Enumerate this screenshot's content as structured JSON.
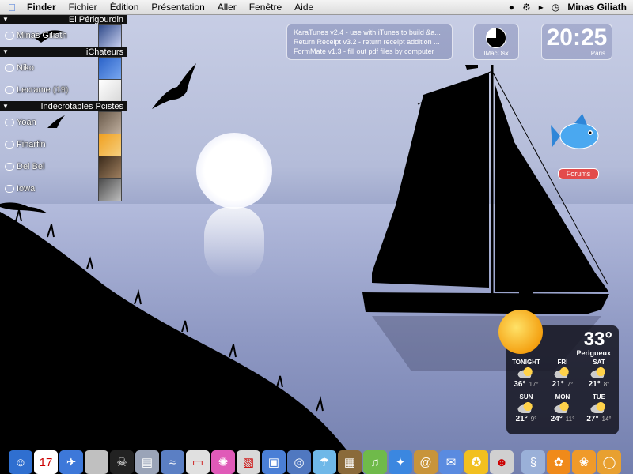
{
  "menubar": {
    "app": "Finder",
    "menus": [
      "Fichier",
      "Édition",
      "Présentation",
      "Aller",
      "Fenêtre",
      "Aide"
    ],
    "user": "Minas Giliath",
    "icons": [
      "apple-icon",
      "lock-icon",
      "gear-icon",
      "speaker-icon",
      "clock-status-icon"
    ]
  },
  "buddies": {
    "groups": [
      {
        "name": "El Périgourdin",
        "items": [
          {
            "name": "Minas Giliath",
            "count": ""
          }
        ]
      },
      {
        "name": "iChateurs",
        "items": [
          {
            "name": "Niko",
            "count": ""
          },
          {
            "name": "Lecrame",
            "count": "(19)"
          }
        ]
      },
      {
        "name": "Indécrotables Pcistes",
        "items": [
          {
            "name": "Yoan",
            "count": ""
          },
          {
            "name": "Finarfin",
            "count": ""
          },
          {
            "name": "Del Bel",
            "count": ""
          },
          {
            "name": "Iowa",
            "count": ""
          }
        ]
      }
    ]
  },
  "ticker": {
    "lines": [
      "KaraTunes v2.4 - use with iTunes to build &a...",
      "Return Receipt v3.2 - return receipt addition ...",
      "FormMate v1.3 - fill out pdf files by computer"
    ]
  },
  "logo": {
    "label": "IMacOsx"
  },
  "clock": {
    "time": "20:25",
    "city": "Paris"
  },
  "forums": {
    "label": "Forums"
  },
  "weather": {
    "temp": "33°",
    "city": "Perigueux",
    "forecast": [
      {
        "label": "TONIGHT",
        "hi": "36°",
        "lo": "17°"
      },
      {
        "label": "FRI",
        "hi": "21°",
        "lo": "7°"
      },
      {
        "label": "SAT",
        "hi": "21°",
        "lo": "8°"
      },
      {
        "label": "SUN",
        "hi": "21°",
        "lo": "9°"
      },
      {
        "label": "MON",
        "hi": "24°",
        "lo": "11°"
      },
      {
        "label": "TUE",
        "hi": "27°",
        "lo": "14°"
      }
    ]
  },
  "dock": {
    "icons": [
      {
        "name": "finder-icon",
        "glyph": "☺",
        "color": "#2f6fd0"
      },
      {
        "name": "calendar-icon",
        "glyph": "17",
        "color": "#ffffff"
      },
      {
        "name": "mail-bird-icon",
        "glyph": "✈",
        "color": "#3d78d9"
      },
      {
        "name": "system-icon",
        "glyph": "",
        "color": "#c0c0c0"
      },
      {
        "name": "pirate-icon",
        "glyph": "☠",
        "color": "#222222"
      },
      {
        "name": "scanner-icon",
        "glyph": "▤",
        "color": "#9aa4b8"
      },
      {
        "name": "dolphin-icon",
        "glyph": "≈",
        "color": "#5b7fc4"
      },
      {
        "name": "toaster-icon",
        "glyph": "▭",
        "color": "#e0e0e0"
      },
      {
        "name": "octopus-icon",
        "glyph": "✺",
        "color": "#e05ab8"
      },
      {
        "name": "documents-icon",
        "glyph": "▧",
        "color": "#d8d8d8"
      },
      {
        "name": "preview-icon",
        "glyph": "▣",
        "color": "#4a7fd6"
      },
      {
        "name": "photos-icon",
        "glyph": "◎",
        "color": "#5078c0"
      },
      {
        "name": "jellyfish-icon",
        "glyph": "☂",
        "color": "#6fb8e8"
      },
      {
        "name": "iphoto-icon",
        "glyph": "▦",
        "color": "#8a6a3a"
      },
      {
        "name": "itunes-icon",
        "glyph": "♫",
        "color": "#6fba4a"
      },
      {
        "name": "safari-icon",
        "glyph": "✦",
        "color": "#3b87e0"
      },
      {
        "name": "address-book-icon",
        "glyph": "@",
        "color": "#c8943a"
      },
      {
        "name": "ichat-icon",
        "glyph": "✉",
        "color": "#5a8be0"
      },
      {
        "name": "aim-icon",
        "glyph": "✪",
        "color": "#f2c020"
      },
      {
        "name": "people-icon",
        "glyph": "☻",
        "color": "#d0d0d0"
      },
      {
        "name": "seahorse-icon",
        "glyph": "§",
        "color": "#9ab0d8"
      },
      {
        "name": "goldfish-icon",
        "glyph": "✿",
        "color": "#f08a1a"
      },
      {
        "name": "orange-fish-icon",
        "glyph": "❀",
        "color": "#f09a2a"
      },
      {
        "name": "fishbowl-icon",
        "glyph": "◯",
        "color": "#e8a030"
      }
    ]
  }
}
